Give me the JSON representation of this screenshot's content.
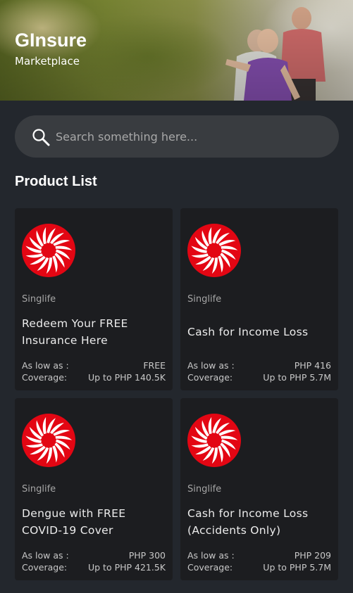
{
  "hero": {
    "title": "GInsure",
    "subtitle": "Marketplace"
  },
  "search": {
    "placeholder": "Search something here..."
  },
  "section_title": "Product List",
  "icons": {
    "search": "search-icon",
    "product_logo": "singlife-logo"
  },
  "colors": {
    "background": "#23272d",
    "card": "#1c1d20",
    "search_bg": "#393c40",
    "logo_red": "#e30613"
  },
  "products": [
    {
      "provider": "Singlife",
      "name": "Redeem Your FREE Insurance Here",
      "price_label": "As low as :",
      "price": "FREE",
      "coverage_label": "Coverage:",
      "coverage": "Up to PHP 140.5K"
    },
    {
      "provider": "Singlife",
      "name": "Cash for Income Loss",
      "price_label": "As low as :",
      "price": "PHP 416",
      "coverage_label": "Coverage:",
      "coverage": "Up to PHP 5.7M"
    },
    {
      "provider": "Singlife",
      "name": "Dengue with FREE COVID-19 Cover",
      "price_label": "As low as :",
      "price": "PHP 300",
      "coverage_label": "Coverage:",
      "coverage": "Up to PHP 421.5K"
    },
    {
      "provider": "Singlife",
      "name": "Cash for Income Loss (Accidents Only)",
      "price_label": "As low as :",
      "price": "PHP 209",
      "coverage_label": "Coverage:",
      "coverage": "Up to PHP 5.7M"
    }
  ]
}
